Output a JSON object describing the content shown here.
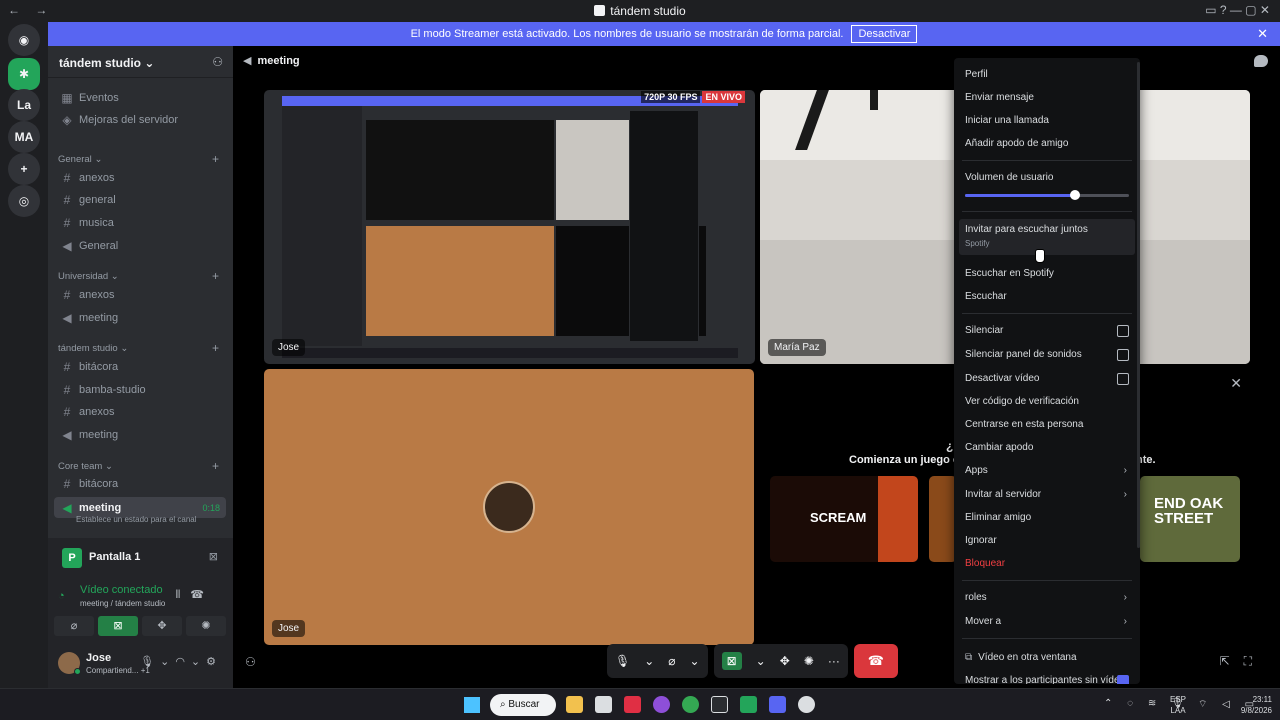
{
  "window": {
    "title": "tándem studio",
    "nav": "← →",
    "controls": "▭ ? — ▢ ✕"
  },
  "banner": {
    "text": "El modo Streamer está activado. Los nombres de usuario se mostrarán de forma parcial.",
    "button": "Desactivar",
    "close": "✕"
  },
  "rail": {
    "servers": [
      "La",
      "MA"
    ],
    "icons": [
      "discord-icon",
      "tandem-icon",
      "add-server-icon",
      "explore-icon"
    ]
  },
  "sidebar": {
    "server_name": "tándem studio",
    "top_items": [
      {
        "label": "Eventos",
        "icon": "calendar-icon"
      },
      {
        "label": "Mejoras del servidor",
        "icon": "boost-icon"
      }
    ],
    "categories": [
      {
        "name": "General",
        "channels": [
          {
            "name": "anexos",
            "type": "text"
          },
          {
            "name": "general",
            "type": "text"
          },
          {
            "name": "musica",
            "type": "text"
          },
          {
            "name": "General",
            "type": "voice"
          }
        ]
      },
      {
        "name": "Universidad",
        "channels": [
          {
            "name": "anexos",
            "type": "text"
          },
          {
            "name": "meeting",
            "type": "stage"
          }
        ]
      },
      {
        "name": "tándem studio",
        "channels": [
          {
            "name": "bitácora",
            "type": "text"
          },
          {
            "name": "bamba-studio",
            "type": "text"
          },
          {
            "name": "anexos",
            "type": "text"
          },
          {
            "name": "meeting",
            "type": "stage"
          }
        ]
      },
      {
        "name": "Core team",
        "channels": [
          {
            "name": "bitácora",
            "type": "text"
          },
          {
            "name": "meeting",
            "type": "stage",
            "active": true,
            "timer": "0:18"
          }
        ]
      }
    ],
    "status_hint": "Establece un estado para el canal"
  },
  "voice_panel": {
    "screen_name": "Pantalla 1",
    "screen_initial": "P",
    "connection_title": "Vídeo conectado",
    "connection_sub": "meeting / tándem studio",
    "user": {
      "name": "Jose",
      "status": "Compartiend...",
      "extra": "+1"
    }
  },
  "main": {
    "channel": "meeting",
    "tiles": [
      {
        "label": "Jose",
        "kind": "screen"
      },
      {
        "label": "María Paz",
        "kind": "camera"
      },
      {
        "label": "Jose",
        "kind": "avatar"
      }
    ],
    "stream_quality": "720P 30 FPS",
    "stream_live": "EN VIVO",
    "activity": {
      "heading": "¿E",
      "subheading_left": "Comienza un juego o u",
      "subheading_right": "nte.",
      "games": [
        "SCREAM",
        "END OAK STREET"
      ]
    }
  },
  "context_menu": {
    "items": [
      {
        "label": "Perfil"
      },
      {
        "label": "Enviar mensaje"
      },
      {
        "label": "Iniciar una llamada"
      },
      {
        "label": "Añadir apodo de amigo"
      },
      {
        "label": "Volumen de usuario",
        "volume": 0.67
      },
      {
        "label": "Invitar para escuchar juntos",
        "sub": "Spotify"
      },
      {
        "label": "Escuchar en Spotify"
      },
      {
        "label": "Escuchar"
      },
      {
        "label": "Silenciar",
        "checkbox": true
      },
      {
        "label": "Silenciar panel de sonidos",
        "checkbox": true
      },
      {
        "label": "Desactivar vídeo",
        "checkbox": true
      },
      {
        "label": "Ver código de verificación"
      },
      {
        "label": "Centrarse en esta persona"
      },
      {
        "label": "Cambiar apodo"
      },
      {
        "label": "Apps",
        "submenu": true
      },
      {
        "label": "Invitar al servidor",
        "submenu": true
      },
      {
        "label": "Eliminar amigo"
      },
      {
        "label": "Ignorar"
      },
      {
        "label": "Bloquear",
        "danger": true
      },
      {
        "label": "roles",
        "submenu": true
      },
      {
        "label": "Mover a",
        "submenu": true
      },
      {
        "label": "Vídeo en otra ventana"
      },
      {
        "label": "Mostrar a los participantes sin vídeo",
        "checked": true
      }
    ]
  },
  "taskbar": {
    "search": "Buscar",
    "lang_top": "ESP",
    "lang_bottom": "LAA",
    "time": "23:11",
    "date": "9/8/2026"
  },
  "colors": {
    "accent": "#5865f2",
    "green": "#23a55a",
    "danger": "#da373c",
    "tan": "#b97a45"
  }
}
